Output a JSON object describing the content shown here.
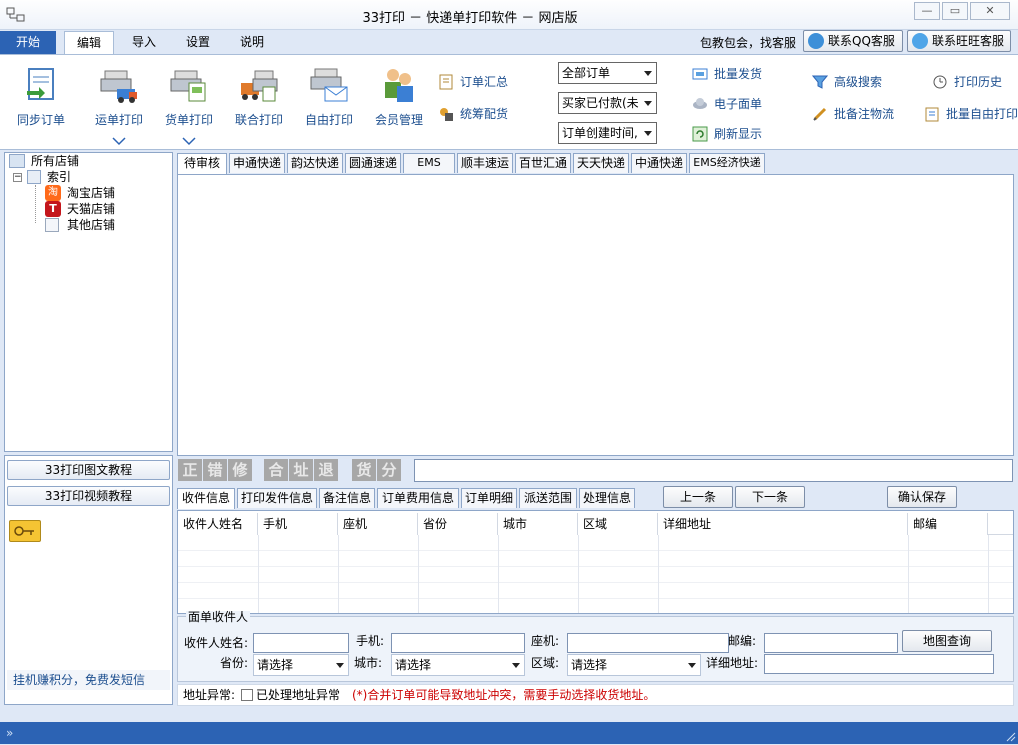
{
  "window": {
    "title": "33打印 － 快递单打印软件 － 网店版"
  },
  "tabs": [
    {
      "label": "开始"
    },
    {
      "label": "编辑"
    },
    {
      "label": "导入"
    },
    {
      "label": "设置"
    },
    {
      "label": "说明"
    }
  ],
  "header_right": {
    "promo": "包教包会，找客服",
    "qq_button": "联系QQ客服",
    "wangwang_button": "联系旺旺客服"
  },
  "ribbon": {
    "sync": "同步订单",
    "waybill": "运单打印",
    "goods": "货单打印",
    "combined": "联合打印",
    "free": "自由打印",
    "member": "会员管理",
    "order_summary": "订单汇总",
    "stock_alloc": "统筹配货",
    "select_orders": "全部订单",
    "select_status": "买家已付款(未",
    "select_time": "订单创建时间,",
    "batch_ship": "批量发货",
    "e_waybill": "电子面单",
    "refresh": "刷新显示",
    "adv_search": "高级搜索",
    "batch_note": "批备注物流",
    "print_history": "打印历史",
    "batch_free": "批量自由打印"
  },
  "tree": {
    "root": "所有店铺",
    "index": "索引",
    "taobao": "淘宝店铺",
    "tmall": "天猫店铺",
    "other": "其他店铺"
  },
  "courier_tabs": [
    "待审核",
    "申通快递",
    "韵达快递",
    "圆通速递",
    "EMS",
    "顺丰速运",
    "百世汇通",
    "天天快递",
    "中通快递",
    "EMS经济快递"
  ],
  "sidebar": {
    "tutorial_text": "33打印图文教程",
    "tutorial_video": "33打印视频教程",
    "bottom_link": "挂机赚积分，免费发短信"
  },
  "flags": [
    "正",
    "错",
    "修",
    "合",
    "址",
    "退",
    "货",
    "分"
  ],
  "info_tabs": [
    "收件信息",
    "打印发件信息",
    "备注信息",
    "订单费用信息",
    "订单明细",
    "派送范围",
    "处理信息"
  ],
  "nav": {
    "prev": "上一条",
    "next": "下一条",
    "confirm": "确认保存"
  },
  "grid_columns": [
    "收件人姓名",
    "手机",
    "座机",
    "省份",
    "城市",
    "区域",
    "详细地址",
    "邮编"
  ],
  "form": {
    "legend": "面单收件人",
    "name_label": "收件人姓名:",
    "mobile_label": "手机:",
    "phone_label": "座机:",
    "zip_label": "邮编:",
    "map_button": "地图查询",
    "province_label": "省份:",
    "province_value": "请选择",
    "city_label": "城市:",
    "city_value": "请选择",
    "area_label": "区域:",
    "area_value": "请选择",
    "address_label": "详细地址:"
  },
  "footer": {
    "addr_abnormal": "地址异常:",
    "handled": "已处理地址异常",
    "warning": "(*)合并订单可能导致地址冲突，需要手动选择收货地址。"
  },
  "colors": {
    "accent": "#2c63b4",
    "warning": "#cc0000",
    "flag_gray": "#a7a7a7"
  }
}
